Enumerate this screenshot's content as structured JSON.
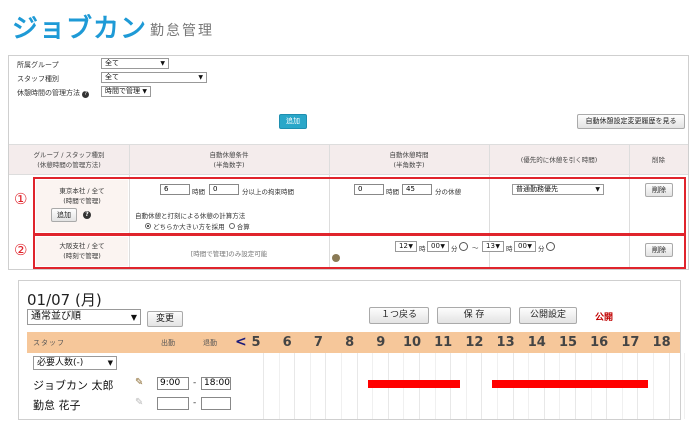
{
  "header": {
    "logo": "ジョブカン",
    "subtitle": "勤怠管理"
  },
  "filters": {
    "group_label": "所属グループ",
    "group_value": "全て",
    "staff_label": "スタッフ種別",
    "staff_value": "全て",
    "break_label": "休憩時間の管理方法",
    "break_value": "時間で管理"
  },
  "buttons": {
    "add": "追加",
    "history": "自動休憩設定変更履歴を見る"
  },
  "table_header": {
    "col1": [
      "グループ / スタッフ種別",
      "(休憩時間の管理方法)"
    ],
    "col2": [
      "自動休憩条件",
      "(半角数字)"
    ],
    "col3": [
      "自動休憩時間",
      "(半角数字)"
    ],
    "col4": "(優先的に休憩を引く時間)",
    "col5": "削除"
  },
  "row1": {
    "marker": "①",
    "group": [
      "東京本社 / 全て",
      "(時間で管理)"
    ],
    "add": "追加",
    "cond_hours": "6",
    "cond_hours_unit": "時間",
    "cond_min": "0",
    "cond_min_unit": "分以上の拘束時間",
    "break_hours": "0",
    "break_hours_unit": "時間",
    "break_min": "45",
    "break_min_unit": "分の休憩",
    "priority": "普通勤務優先",
    "delete": "削除",
    "calc_label": "自動休憩と打刻による休憩の計算方法",
    "opt1": "どちらか大きい方を採用",
    "opt2": "合算"
  },
  "row2": {
    "marker": "②",
    "group": [
      "大阪支社 / 全て",
      "(時刻で管理)"
    ],
    "note": "[時間で管理]のみ設定可能",
    "from_h": "12",
    "from_m": "00",
    "to_h": "13",
    "to_m": "00",
    "h_unit": "時",
    "m_unit": "分",
    "tilde": "〜",
    "delete": "削除"
  },
  "schedule": {
    "date": "01/07 (月)",
    "sort_value": "通常並び順",
    "change": "変更",
    "back": "１つ戻る",
    "save": "保 存",
    "publish_settings": "公開設定",
    "public": "公開",
    "col_staff": "スタッフ",
    "col_in": "出勤",
    "col_out": "退勤",
    "arrow": "<",
    "hours": [
      "5",
      "6",
      "7",
      "8",
      "9",
      "10",
      "11",
      "12",
      "13",
      "14",
      "15",
      "16",
      "17",
      "18"
    ],
    "need_label": "必要人数(-)",
    "staff": [
      {
        "name": "ジョブカン 太郎",
        "in": "9:00",
        "dash": "-",
        "out": "18:00"
      },
      {
        "name": "勤怠 花子",
        "in": "",
        "dash": "-",
        "out": ""
      }
    ]
  }
}
